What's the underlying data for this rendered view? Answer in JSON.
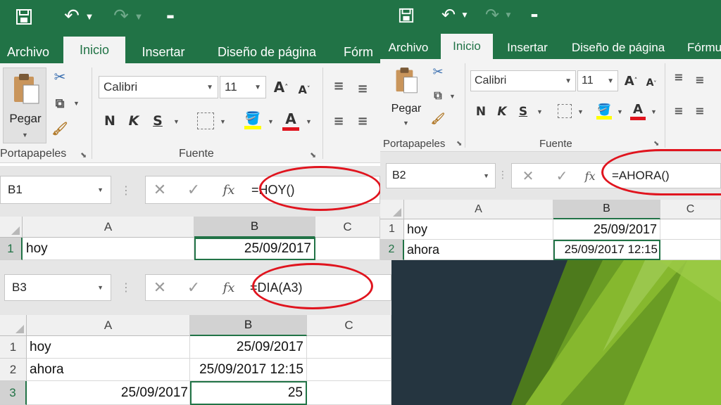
{
  "left_window": {
    "tabs": [
      "Archivo",
      "Inicio",
      "Insertar",
      "Diseño de página",
      "Fórm"
    ],
    "active_tab": "Inicio",
    "ribbon": {
      "paste_label": "Pegar",
      "font_name": "Calibri",
      "font_size": "11",
      "bold": "N",
      "italic": "K",
      "underline": "S",
      "clipboard_group": "Portapapeles",
      "font_group": "Fuente"
    },
    "formula_bar_1": {
      "cell_ref": "B1",
      "formula": "=HOY()"
    },
    "grid_1": {
      "columns": [
        "A",
        "B",
        "C"
      ],
      "rows": [
        {
          "num": "1",
          "a": "hoy",
          "b": "25/09/2017",
          "c": ""
        }
      ]
    },
    "formula_bar_2": {
      "cell_ref": "B3",
      "formula": "=DIA(A3)"
    },
    "grid_2": {
      "columns": [
        "A",
        "B",
        "C"
      ],
      "rows": [
        {
          "num": "1",
          "a": "hoy",
          "b": "25/09/2017",
          "c": ""
        },
        {
          "num": "2",
          "a": "ahora",
          "b": "25/09/2017 12:15",
          "c": ""
        },
        {
          "num": "3",
          "a": "25/09/2017",
          "b": "25",
          "c": ""
        }
      ]
    }
  },
  "right_window": {
    "tabs": [
      "Archivo",
      "Inicio",
      "Insertar",
      "Diseño de página",
      "Fórmu"
    ],
    "active_tab": "Inicio",
    "ribbon": {
      "paste_label": "Pegar",
      "font_name": "Calibri",
      "font_size": "11",
      "bold": "N",
      "italic": "K",
      "underline": "S",
      "clipboard_group": "Portapapeles",
      "font_group": "Fuente"
    },
    "formula_bar": {
      "cell_ref": "B2",
      "formula": "=AHORA()"
    },
    "grid": {
      "columns": [
        "A",
        "B",
        "C"
      ],
      "rows": [
        {
          "num": "1",
          "a": "hoy",
          "b": "25/09/2017",
          "c": ""
        },
        {
          "num": "2",
          "a": "ahora",
          "b": "25/09/2017 12:15",
          "c": ""
        }
      ]
    }
  },
  "icons": {
    "save": "save-icon",
    "undo": "undo-icon",
    "redo": "redo-icon",
    "customize": "customize-qat-icon",
    "cut": "scissors-icon",
    "copy": "copy-icon",
    "format_painter": "brush-icon",
    "cancel": "cancel-x-icon",
    "enter": "checkmark-icon",
    "function": "fx-icon"
  },
  "colors": {
    "excel_green": "#217346",
    "annotation_red": "#e0141e",
    "selection_green": "#217346"
  }
}
